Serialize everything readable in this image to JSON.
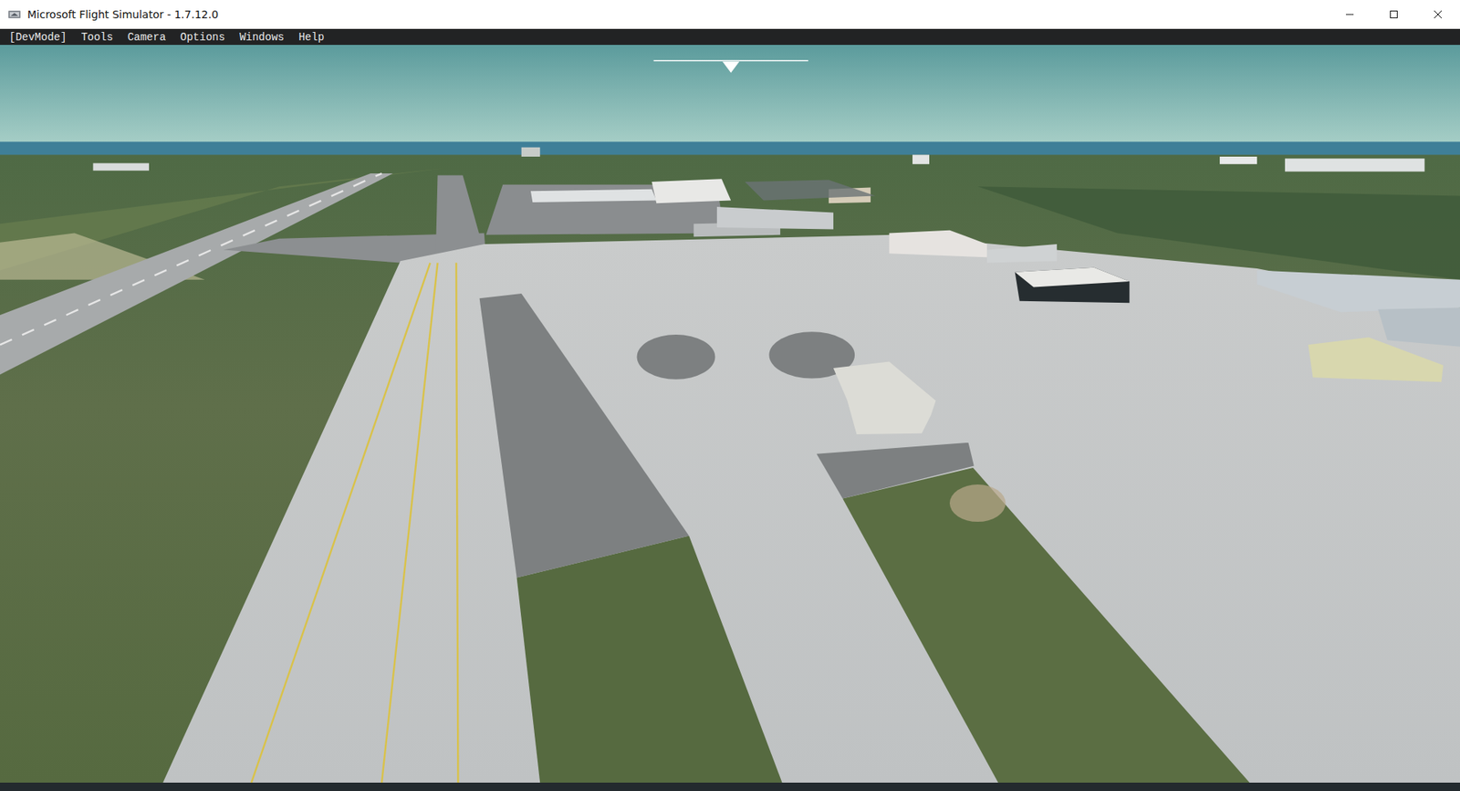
{
  "window": {
    "title": "Microsoft Flight Simulator - 1.7.12.0"
  },
  "menu_bar": {
    "items": [
      {
        "label": "[DevMode]"
      },
      {
        "label": "Tools"
      },
      {
        "label": "Camera"
      },
      {
        "label": "Options"
      },
      {
        "label": "Windows"
      },
      {
        "label": "Help"
      }
    ]
  },
  "game_view": {
    "scene": "Aerial view of an airport with runway, taxiways, apron and hangars near the coast"
  }
}
